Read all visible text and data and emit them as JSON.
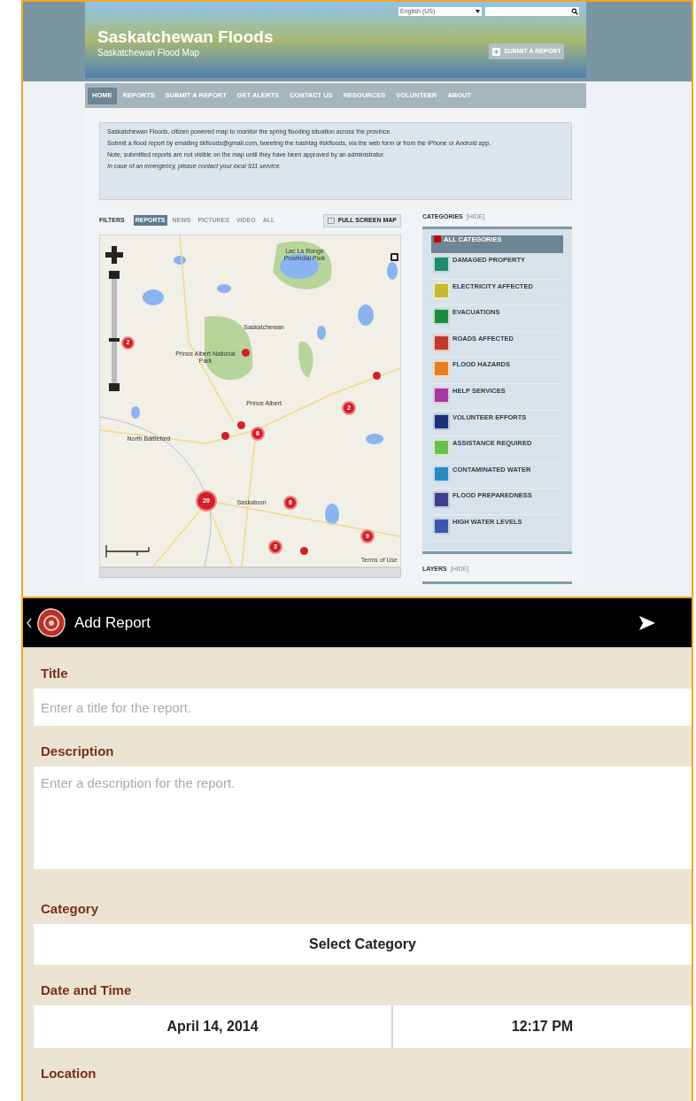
{
  "site": {
    "title": "Saskatchewan Floods",
    "subtitle": "Saskatchewan Flood Map",
    "language": "English (US)",
    "submit_button": "SUBMIT A REPORT"
  },
  "nav": [
    {
      "label": "HOME",
      "selected": true
    },
    {
      "label": "REPORTS",
      "selected": false
    },
    {
      "label": "SUBMIT A REPORT",
      "selected": false
    },
    {
      "label": "GET ALERTS",
      "selected": false
    },
    {
      "label": "CONTACT US",
      "selected": false
    },
    {
      "label": "RESOURCES",
      "selected": false
    },
    {
      "label": "VOLUNTEER",
      "selected": false
    },
    {
      "label": "ABOUT",
      "selected": false
    }
  ],
  "info": [
    {
      "text": "Saskatchewan Floods, citizen powered map to monitor the spring flooding situation across the province.",
      "italic": false
    },
    {
      "text": "Submit a flood report by emailing skfloods@gmail.com, tweeting the hashtag #skfloods, via the web form or from the iPhone or Android app.",
      "italic": false
    },
    {
      "text": "Note, submitted reports are not visible on the map until they have been approved by an administrator.",
      "italic": false
    },
    {
      "text": "In case of an emergency, please contact your local 911 service.",
      "italic": true
    }
  ],
  "filters": {
    "label": "FILTERS",
    "items": [
      {
        "label": "REPORTS",
        "selected": true
      },
      {
        "label": "NEWS",
        "selected": false
      },
      {
        "label": "PICTURES",
        "selected": false
      },
      {
        "label": "VIDEO",
        "selected": false
      },
      {
        "label": "ALL",
        "selected": false
      }
    ],
    "full_screen_button": "FULL SCREEN MAP"
  },
  "map": {
    "place_labels": [
      "Lac La Ronge Provincial Park",
      "Saskatchewan",
      "Prince Albert National Park",
      "Prince Albert",
      "North Battleford",
      "Saskatoon"
    ],
    "clusters": [
      {
        "label": "2"
      },
      {
        "label": "2"
      },
      {
        "label": "8"
      },
      {
        "label": "20"
      },
      {
        "label": "6"
      },
      {
        "label": "3"
      },
      {
        "label": "9"
      }
    ],
    "terms": "Terms of Use"
  },
  "categories": {
    "title": "CATEGORIES",
    "hide": "[HIDE]",
    "items": [
      {
        "label": "ALL CATEGORIES",
        "color": "#cc0000",
        "selected": true
      },
      {
        "label": "DAMAGED PROPERTY",
        "color": "#1f8a6e",
        "selected": false
      },
      {
        "label": "ELECTRICITY AFFECTED",
        "color": "#c8b832",
        "selected": false
      },
      {
        "label": "EVACUATIONS",
        "color": "#1e8a3e",
        "selected": false
      },
      {
        "label": "ROADS AFFECTED",
        "color": "#c0392b",
        "selected": false
      },
      {
        "label": "FLOOD HAZARDS",
        "color": "#e67e22",
        "selected": false
      },
      {
        "label": "HELP SERVICES",
        "color": "#a33a9c",
        "selected": false
      },
      {
        "label": "VOLUNTEER EFFORTS",
        "color": "#1c2f7a",
        "selected": false
      },
      {
        "label": "ASSISTANCE REQUIRED",
        "color": "#6cc04a",
        "selected": false
      },
      {
        "label": "CONTAMINATED WATER",
        "color": "#2a8ac0",
        "selected": false
      },
      {
        "label": "FLOOD PREPAREDNESS",
        "color": "#3b3f8c",
        "selected": false
      },
      {
        "label": "HIGH WATER LEVELS",
        "color": "#3d58a8",
        "selected": false
      }
    ]
  },
  "layers": {
    "title": "LAYERS",
    "hide": "[HIDE]"
  },
  "app": {
    "title": "Add Report",
    "fields": [
      {
        "kind": "text",
        "label": "Title",
        "placeholder": "Enter a title for the report."
      },
      {
        "kind": "textarea",
        "label": "Description",
        "placeholder": "Enter a description for the report."
      },
      {
        "kind": "select",
        "label": "Category",
        "value": "Select Category"
      },
      {
        "kind": "datetime",
        "label": "Date and Time",
        "date": "April 14, 2014",
        "time": "12:17 PM"
      },
      {
        "kind": "heading",
        "label": "Location"
      }
    ]
  }
}
